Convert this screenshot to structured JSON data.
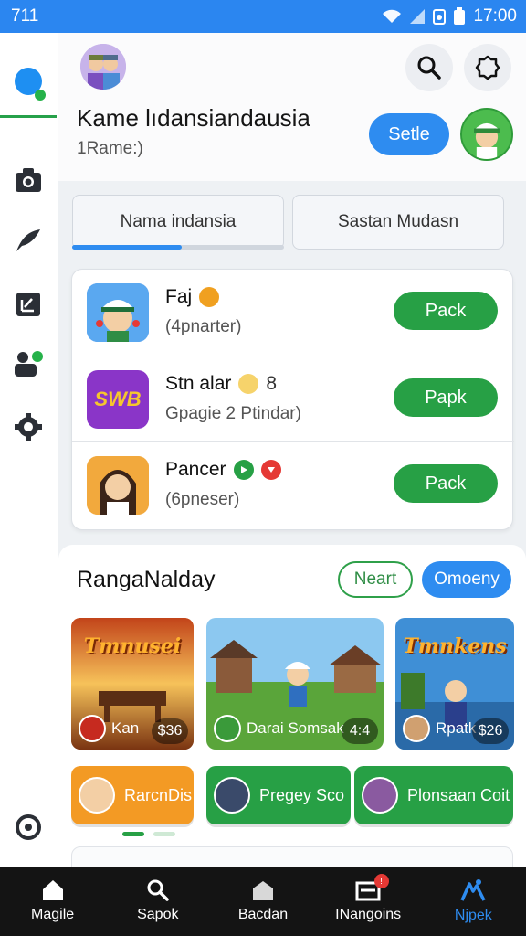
{
  "status_bar": {
    "time_left": "711",
    "time_right": "17:00"
  },
  "header": {
    "title": "Kame lıdansiandausia",
    "subtitle": "1Rame:)",
    "setle_label": "Setle"
  },
  "tabs": [
    {
      "label": "Nama indansia",
      "active": true
    },
    {
      "label": "Sastan Mudasn",
      "active": false
    }
  ],
  "games": [
    {
      "name": "Faj",
      "subtitle": "(4pnarter)",
      "button": "Pack",
      "extra": ""
    },
    {
      "name": "Stn alar",
      "subtitle": "Gpagie 2 Ptindar)",
      "button": "Papk",
      "extra": "8",
      "thumb_text": "SWB"
    },
    {
      "name": "Pancer",
      "subtitle": "(6pneser)",
      "button": "Pack",
      "extra": ""
    }
  ],
  "featured": {
    "title": "RangaNalday",
    "pill_outline": "Neart",
    "pill_fill": "Omoeny",
    "tiles": [
      {
        "banner": "Tmnusei",
        "label": "Kan",
        "price": "$36"
      },
      {
        "banner": "",
        "label": "Darai Somsak",
        "price": "4:4"
      },
      {
        "banner": "Tmnkens",
        "label": "Rpatk",
        "price": "$26"
      }
    ],
    "chips": [
      {
        "label": "RarcnDis"
      },
      {
        "label": "Pregey Sco"
      },
      {
        "label": "Plonsaan Coit"
      }
    ]
  },
  "bottom_nav": [
    {
      "label": "Magile",
      "icon": "home-icon",
      "active": false
    },
    {
      "label": "Sapok",
      "icon": "search-icon",
      "active": false
    },
    {
      "label": "Bacdan",
      "icon": "store-icon",
      "active": false
    },
    {
      "label": "INangoins",
      "icon": "inbox-icon",
      "active": false,
      "badge": "!"
    },
    {
      "label": "Njpek",
      "icon": "profile-icon",
      "active": true
    }
  ],
  "colors": {
    "accent_blue": "#2e8cf0",
    "accent_green": "#27a045",
    "nav_bg": "#141414"
  }
}
